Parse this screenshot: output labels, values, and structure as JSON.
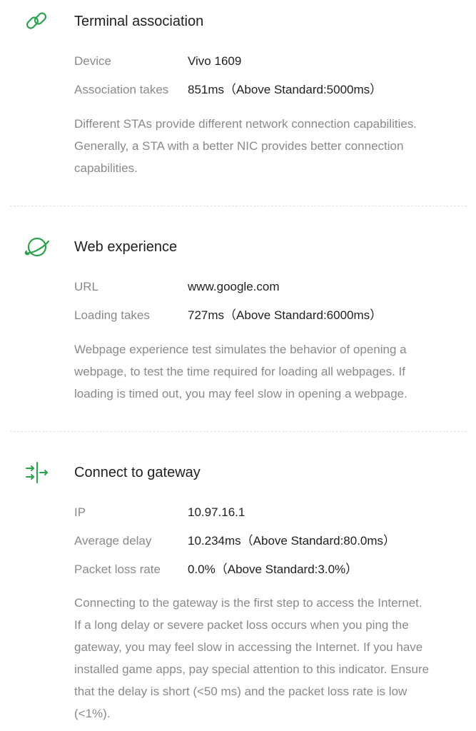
{
  "accent_color": "#2aa34a",
  "sections": [
    {
      "icon": "link-icon",
      "title": "Terminal association",
      "rows": [
        {
          "label": "Device",
          "value": "Vivo 1609"
        },
        {
          "label": "Association takes",
          "value": "851ms（Above Standard:5000ms）"
        }
      ],
      "description": "Different STAs provide different network connection capabilities.\n Generally, a STA with a better NIC provides better connection\ncapabilities."
    },
    {
      "icon": "planet-icon",
      "title": "Web experience",
      "rows": [
        {
          "label": "URL",
          "value": "www.google.com"
        },
        {
          "label": "Loading takes",
          "value": "727ms（Above Standard:6000ms）"
        }
      ],
      "description": "Webpage experience test simulates the behavior of opening a\nwebpage, to test the time required for loading all webpages. If\nloading is timed out, you may feel slow in opening a webpage."
    },
    {
      "icon": "gateway-arrows-icon",
      "title": "Connect to gateway",
      "rows": [
        {
          "label": "IP",
          "value": "10.97.16.1"
        },
        {
          "label": "Average delay",
          "value": "10.234ms（Above Standard:80.0ms）"
        },
        {
          "label": "Packet loss rate",
          "value": "0.0%（Above Standard:3.0%）"
        }
      ],
      "description": "Connecting to the gateway is the first step to access the Internet.\nIf a long delay or severe packet loss occurs when you ping the\ngateway, you may feel slow in accessing the Internet. If you have\ninstalled game apps, pay special attention to this indicator. Ensure\nthat the delay is short (<50 ms) and the packet loss rate is low\n(<1%)."
    }
  ]
}
